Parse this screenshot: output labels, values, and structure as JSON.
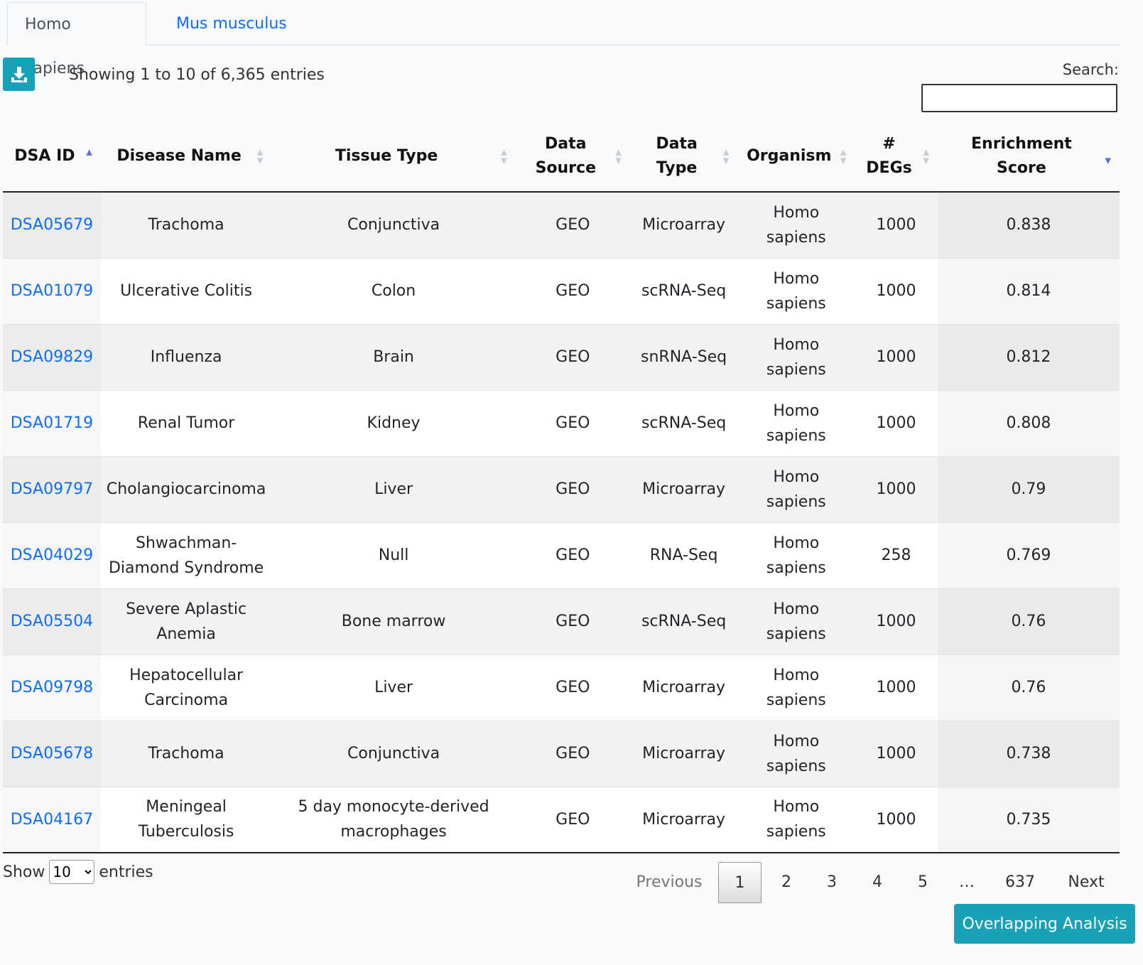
{
  "tabs": [
    {
      "label": "Homo sapiens",
      "active": true
    },
    {
      "label": "Mus musculus",
      "active": false
    }
  ],
  "toolbar": {
    "download_icon": "download-icon",
    "info": "Showing 1 to 10 of 6,365 entries",
    "search_label": "Search:",
    "search_value": ""
  },
  "table": {
    "columns": [
      {
        "label": "DSA ID",
        "sort": "asc"
      },
      {
        "label": "Disease Name",
        "sort": "none"
      },
      {
        "label": "Tissue Type",
        "sort": "none"
      },
      {
        "label": "Data Source",
        "sort": "none"
      },
      {
        "label": "Data Type",
        "sort": "none"
      },
      {
        "label": "Organism",
        "sort": "none"
      },
      {
        "label": "# DEGs",
        "sort": "none"
      },
      {
        "label": "Enrichment Score",
        "sort": "desc"
      }
    ],
    "rows": [
      [
        "DSA05679",
        "Trachoma",
        "Conjunctiva",
        "GEO",
        "Microarray",
        "Homo sapiens",
        "1000",
        "0.838"
      ],
      [
        "DSA01079",
        "Ulcerative Colitis",
        "Colon",
        "GEO",
        "scRNA-Seq",
        "Homo sapiens",
        "1000",
        "0.814"
      ],
      [
        "DSA09829",
        "Influenza",
        "Brain",
        "GEO",
        "snRNA-Seq",
        "Homo sapiens",
        "1000",
        "0.812"
      ],
      [
        "DSA01719",
        "Renal Tumor",
        "Kidney",
        "GEO",
        "scRNA-Seq",
        "Homo sapiens",
        "1000",
        "0.808"
      ],
      [
        "DSA09797",
        "Cholangiocarcinoma",
        "Liver",
        "GEO",
        "Microarray",
        "Homo sapiens",
        "1000",
        "0.79"
      ],
      [
        "DSA04029",
        "Shwachman-Diamond Syndrome",
        "Null",
        "GEO",
        "RNA-Seq",
        "Homo sapiens",
        "258",
        "0.769"
      ],
      [
        "DSA05504",
        "Severe Aplastic Anemia",
        "Bone marrow",
        "GEO",
        "scRNA-Seq",
        "Homo sapiens",
        "1000",
        "0.76"
      ],
      [
        "DSA09798",
        "Hepatocellular Carcinoma",
        "Liver",
        "GEO",
        "Microarray",
        "Homo sapiens",
        "1000",
        "0.76"
      ],
      [
        "DSA05678",
        "Trachoma",
        "Conjunctiva",
        "GEO",
        "Microarray",
        "Homo sapiens",
        "1000",
        "0.738"
      ],
      [
        "DSA04167",
        "Meningeal Tuberculosis",
        "5 day monocyte-derived macrophages",
        "GEO",
        "Microarray",
        "Homo sapiens",
        "1000",
        "0.735"
      ]
    ]
  },
  "length": {
    "show": "Show",
    "value": "10",
    "options": [
      "10"
    ],
    "entries": "entries"
  },
  "pagination": {
    "previous": "Previous",
    "pages": [
      "1",
      "2",
      "3",
      "4",
      "5"
    ],
    "current": "1",
    "ellipsis": "…",
    "last": "637",
    "next": "Next"
  },
  "overlap_button": "Overlapping Analysis",
  "colors": {
    "accent": "#17a2b8",
    "link": "#0d6efd"
  }
}
